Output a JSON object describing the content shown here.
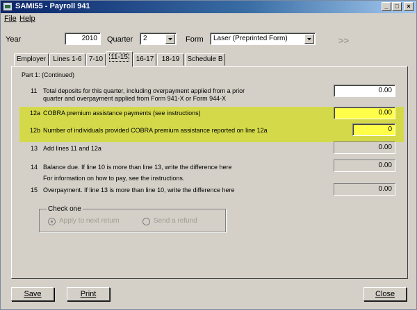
{
  "window": {
    "title": "SAMI55 - Payroll 941"
  },
  "menu": {
    "file": "File",
    "help": "Help"
  },
  "header": {
    "year_label": "Year",
    "year_value": "2010",
    "quarter_label": "Quarter",
    "quarter_value": "2",
    "form_label": "Form",
    "form_value": "Laser (Preprinted Form)",
    "next_glyph": ">>"
  },
  "tabs": [
    "Employer",
    "Lines 1-6",
    "7-10",
    "11-15",
    "16-17",
    "18-19",
    "Schedule B"
  ],
  "part_heading": "Part 1: (Continued)",
  "lines": {
    "l11": {
      "num": "11",
      "text1": "Total deposits for this quarter, including overpayment applied from a prior",
      "text2": "quarter and overpayment applied from Form 941-X or Form 944-X",
      "amount": "0.00"
    },
    "l12a": {
      "num": "12a",
      "text": "COBRA premium assistance payments (see instructions)",
      "amount": "0.00"
    },
    "l12b": {
      "num": "12b",
      "text": "Number of individuals provided COBRA premium assistance reported on line 12a",
      "amount": "0"
    },
    "l13": {
      "num": "13",
      "text": "Add lines 11 and 12a",
      "amount": "0.00"
    },
    "l14": {
      "num": "14",
      "text": "Balance due. If line 10 is more than line 13, write the difference here",
      "note": "For information on how to pay, see the instructions.",
      "amount": "0.00"
    },
    "l15": {
      "num": "15",
      "text": "Overpayment. If line 13 is more than line 10, write the difference here",
      "amount": "0.00"
    }
  },
  "check_one": {
    "title": "Check one",
    "apply": "Apply to next return",
    "refund": "Send a refund"
  },
  "buttons": {
    "save": "Save",
    "print": "Print",
    "close": "Close"
  },
  "colors": {
    "highlight": "#d4d94a",
    "yellow_field": "#ffff4a",
    "titlebar": "#0a246a"
  }
}
